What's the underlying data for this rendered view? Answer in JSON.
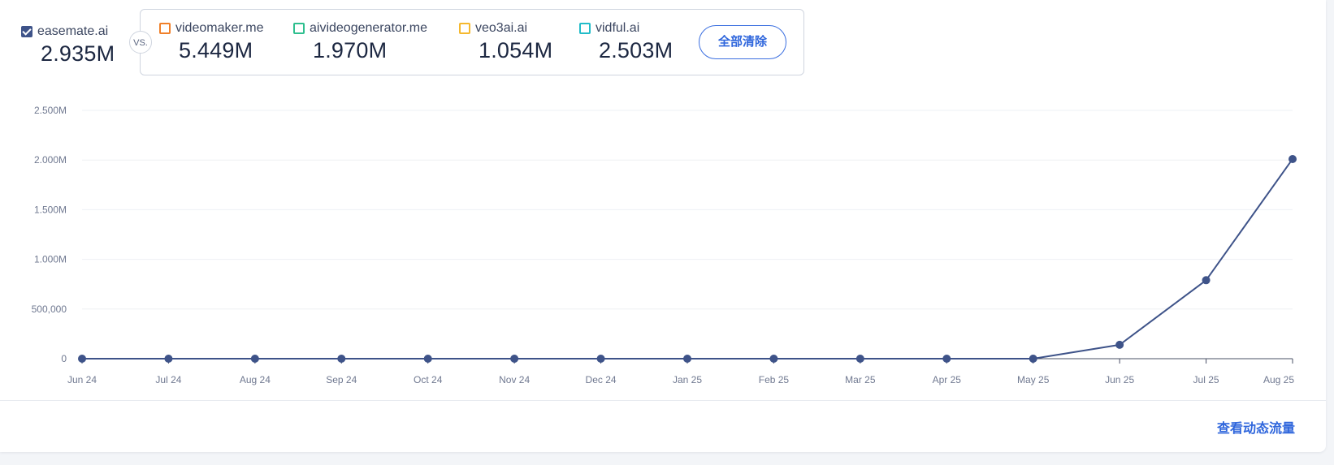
{
  "primary": {
    "name": "easemate.ai",
    "value": "2.935M",
    "color": "#3e5389",
    "checked": true
  },
  "vs_label": "VS.",
  "competitors": [
    {
      "name": "videomaker.me",
      "value": "5.449M",
      "color": "#f0802a"
    },
    {
      "name": "aivideogenerator.me",
      "value": "1.970M",
      "color": "#2fbf8f"
    },
    {
      "name": "veo3ai.ai",
      "value": "1.054M",
      "color": "#f5b82e"
    },
    {
      "name": "vidful.ai",
      "value": "2.503M",
      "color": "#22bcc9"
    }
  ],
  "clear_all_label": "全部清除",
  "view_dynamic_traffic_label": "查看动态流量",
  "chart_data": {
    "type": "line",
    "categories": [
      "Jun 24",
      "Jul 24",
      "Aug 24",
      "Sep 24",
      "Oct 24",
      "Nov 24",
      "Dec 24",
      "Jan 25",
      "Feb 25",
      "Mar 25",
      "Apr 25",
      "May 25",
      "Jun 25",
      "Jul 25",
      "Aug 25"
    ],
    "series": [
      {
        "name": "easemate.ai",
        "color": "#3e5389",
        "values": [
          0,
          0,
          0,
          0,
          0,
          0,
          0,
          0,
          0,
          0,
          0,
          0,
          140000,
          790000,
          2010000
        ]
      }
    ],
    "y_ticks": [
      {
        "value": 0,
        "label": "0"
      },
      {
        "value": 500000,
        "label": "500,000"
      },
      {
        "value": 1000000,
        "label": "1.000M"
      },
      {
        "value": 1500000,
        "label": "1.500M"
      },
      {
        "value": 2000000,
        "label": "2.000M"
      },
      {
        "value": 2500000,
        "label": "2.500M"
      }
    ],
    "ylim": [
      0,
      2500000
    ],
    "grid": true,
    "legend": "top"
  }
}
